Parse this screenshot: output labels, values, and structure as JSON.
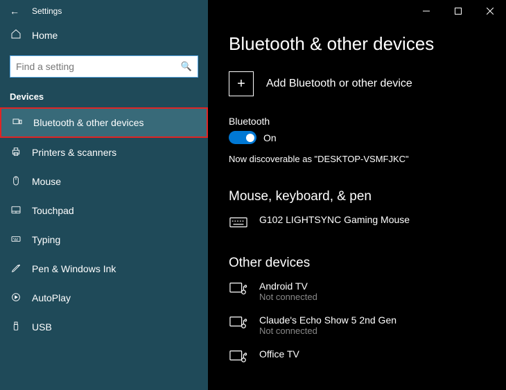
{
  "titlebar": {
    "title": "Settings"
  },
  "home": {
    "label": "Home"
  },
  "search": {
    "placeholder": "Find a setting"
  },
  "section": {
    "label": "Devices"
  },
  "nav": {
    "items": [
      {
        "label": "Bluetooth & other devices"
      },
      {
        "label": "Printers & scanners"
      },
      {
        "label": "Mouse"
      },
      {
        "label": "Touchpad"
      },
      {
        "label": "Typing"
      },
      {
        "label": "Pen & Windows Ink"
      },
      {
        "label": "AutoPlay"
      },
      {
        "label": "USB"
      }
    ]
  },
  "page": {
    "title": "Bluetooth & other devices",
    "add_label": "Add Bluetooth or other device",
    "bt_label": "Bluetooth",
    "bt_state": "On",
    "discoverable": "Now discoverable as \"DESKTOP-VSMFJKC\"",
    "section1": "Mouse, keyboard, & pen",
    "dev1": {
      "name": "G102 LIGHTSYNC Gaming Mouse"
    },
    "section2": "Other devices",
    "other": [
      {
        "name": "Android TV",
        "status": "Not connected"
      },
      {
        "name": "Claude's Echo Show 5 2nd Gen",
        "status": "Not connected"
      },
      {
        "name": "Office TV",
        "status": ""
      }
    ]
  }
}
